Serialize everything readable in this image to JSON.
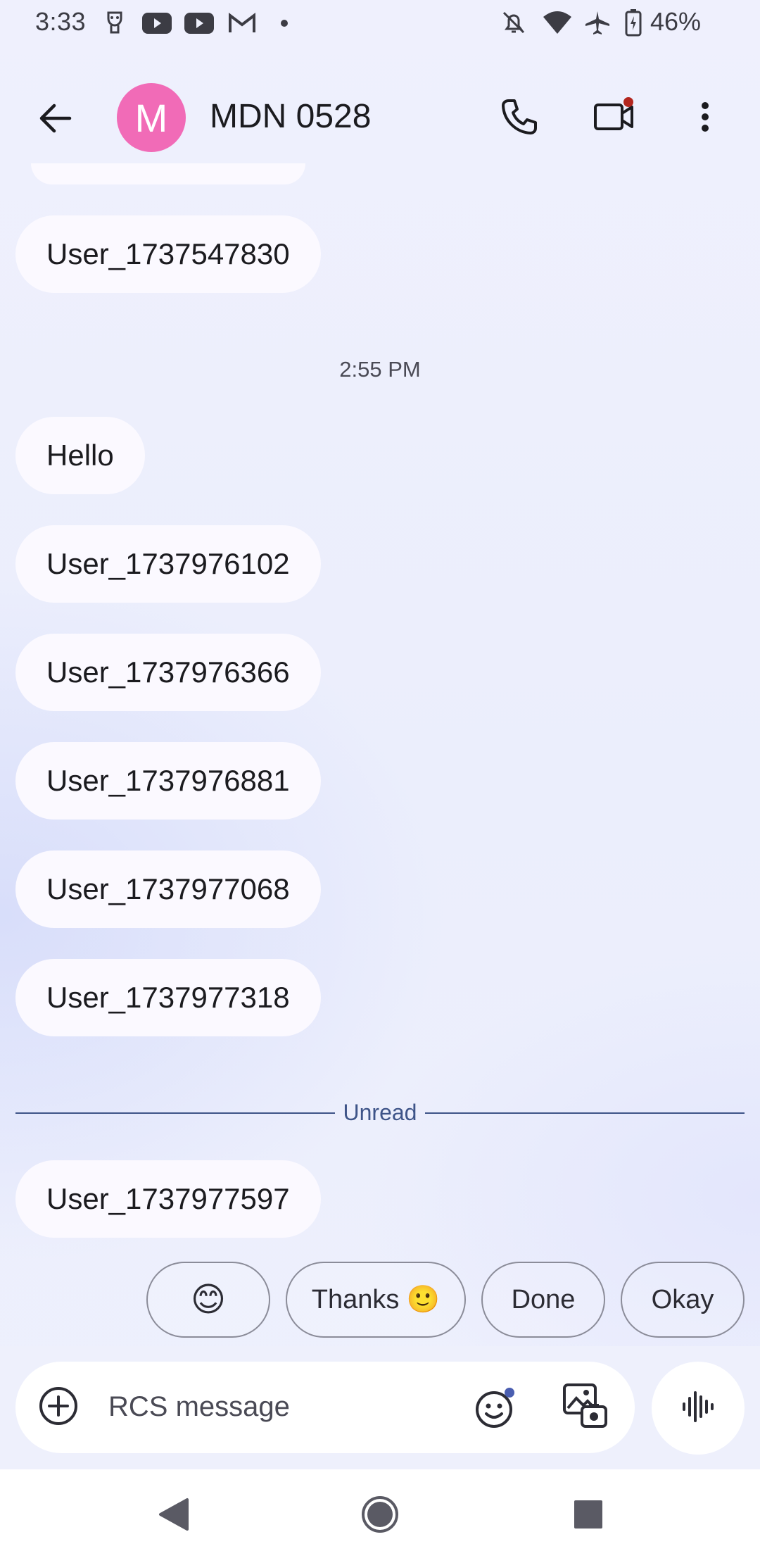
{
  "status_bar": {
    "time": "3:33",
    "battery": "46%",
    "icons": [
      "face-icon",
      "youtube-icon",
      "youtube-icon",
      "gmail-icon",
      "dot-icon",
      "bell-off-icon",
      "wifi-icon",
      "airplane-icon",
      "battery-charging-icon"
    ]
  },
  "header": {
    "avatar_letter": "M",
    "avatar_color": "#f16bb7",
    "contact_name": "MDN 0528",
    "icons": [
      "back-arrow-icon",
      "phone-icon",
      "video-camera-icon",
      "more-vert-icon"
    ]
  },
  "conversation": {
    "messages_before": [
      {
        "text": "User_1737547830"
      }
    ],
    "timestamp": "2:55 PM",
    "messages": [
      {
        "text": "Hello"
      },
      {
        "text": "User_1737976102"
      },
      {
        "text": "User_1737976366"
      },
      {
        "text": "User_1737976881"
      },
      {
        "text": "User_1737977068"
      },
      {
        "text": "User_1737977318"
      }
    ],
    "unread_label": "Unread",
    "unread_messages": [
      {
        "text": "User_1737977597"
      }
    ]
  },
  "suggestions": [
    {
      "label": "😊"
    },
    {
      "label": "Thanks 🙂"
    },
    {
      "label": "Done"
    },
    {
      "label": "Okay"
    }
  ],
  "composer": {
    "placeholder": "RCS message",
    "icons": [
      "add-circle-icon",
      "emoji-icon",
      "gallery-icon",
      "voice-waveform-icon"
    ]
  },
  "nav_bar": {
    "icons": [
      "nav-back-icon",
      "nav-home-icon",
      "nav-recents-icon"
    ]
  },
  "colors": {
    "background": "#eef0fc",
    "bubble": "#fbf9ff",
    "accent": "#3e5488",
    "video_badge": "#b3261e"
  }
}
